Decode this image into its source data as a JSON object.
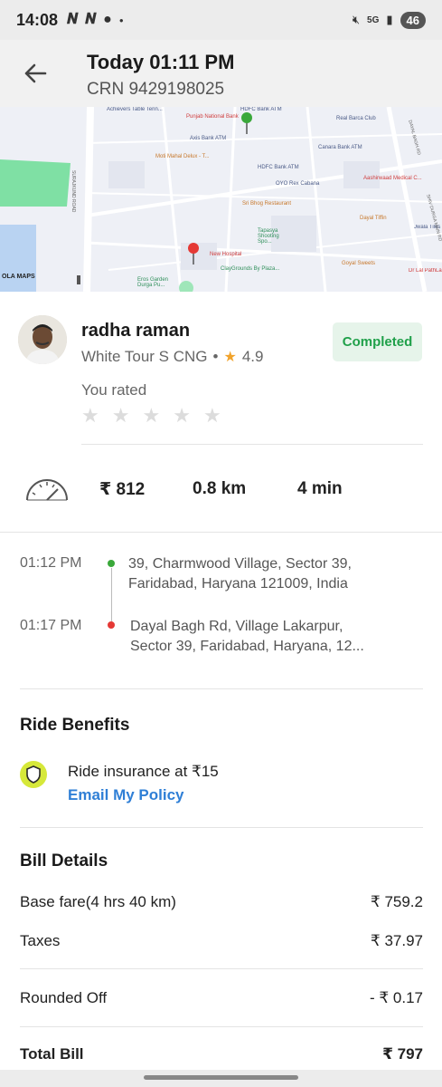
{
  "status_bar": {
    "time": "14:08",
    "battery": "46"
  },
  "header": {
    "title": "Today 01:11 PM",
    "crn": "CRN 9429198025"
  },
  "map": {
    "labels": {
      "achievers": "Achievers Table Tenn...",
      "hdfc1": "HDFC Bank ATM",
      "pnb": "Punjab National Bank",
      "axis": "Axis Bank ATM",
      "motimahal": "Moti Mahal Delux - T...",
      "hdfc2": "HDFC Bank ATM",
      "oyo": "OYO Rex Cabana",
      "sbhog": "Sri Bhog Restaurant",
      "tapasya": "Tapasya Shooting Spo...",
      "newhospital": "New Hospital",
      "claygrounds": "ClayGrounds By Plaza...",
      "eros": "Eros Garden Durga Pu...",
      "realbarca": "Real Barca Club",
      "canara": "Canara Bank ATM",
      "aashirwad": "Aashirwaad Medical C...",
      "dayaltiffin": "Dayal Tiffin",
      "jwala": "Jwala Tiles",
      "goyal": "Goyal Sweets",
      "drlal": "Dr Lal PathLa...",
      "surajkund": "SURAJKUND ROAD",
      "dayalbagh": "DAYAL BAGH RD",
      "shivdurga": "SHIV DURGA MAIN RD",
      "ola_maps": "OLA MAPS"
    }
  },
  "driver": {
    "name": "radha raman",
    "vehicle": "White Tour S CNG",
    "separator": "•",
    "rating": "4.9",
    "status": "Completed",
    "rated_label": "You rated"
  },
  "trip": {
    "fare": "₹ 812",
    "distance": "0.8 km",
    "duration": "4 min"
  },
  "timeline": {
    "pickup_time": "01:12 PM",
    "pickup_line1": "39, Charmwood Village, Sector 39,",
    "pickup_line2": "Faridabad, Haryana 121009, India",
    "drop_time": "01:17 PM",
    "drop_line1": "Dayal Bagh Rd, Village Lakarpur,",
    "drop_line2": "Sector 39, Faridabad, Haryana, 12..."
  },
  "benefits": {
    "title": "Ride Benefits",
    "insurance": "Ride insurance at ₹15",
    "email_link": "Email My Policy"
  },
  "bill": {
    "title": "Bill Details",
    "rows": [
      {
        "label": "Base fare(4 hrs 40 km)",
        "value": "₹ 759.2"
      },
      {
        "label": "Taxes",
        "value": "₹ 37.97"
      },
      {
        "label": "Rounded Off",
        "value": "- ₹ 0.17"
      }
    ],
    "total_label": "Total Bill",
    "total_value": "₹ 797"
  },
  "colors": {
    "accent_blue": "#2f7fd6",
    "success_green": "#20a04a",
    "star_orange": "#f1a32c",
    "pickup_green": "#3aa83a",
    "drop_red": "#e53935"
  },
  "icons": [
    "back-arrow-icon",
    "speedometer-icon",
    "shield-icon",
    "star-icon",
    "map-pin-icon"
  ]
}
